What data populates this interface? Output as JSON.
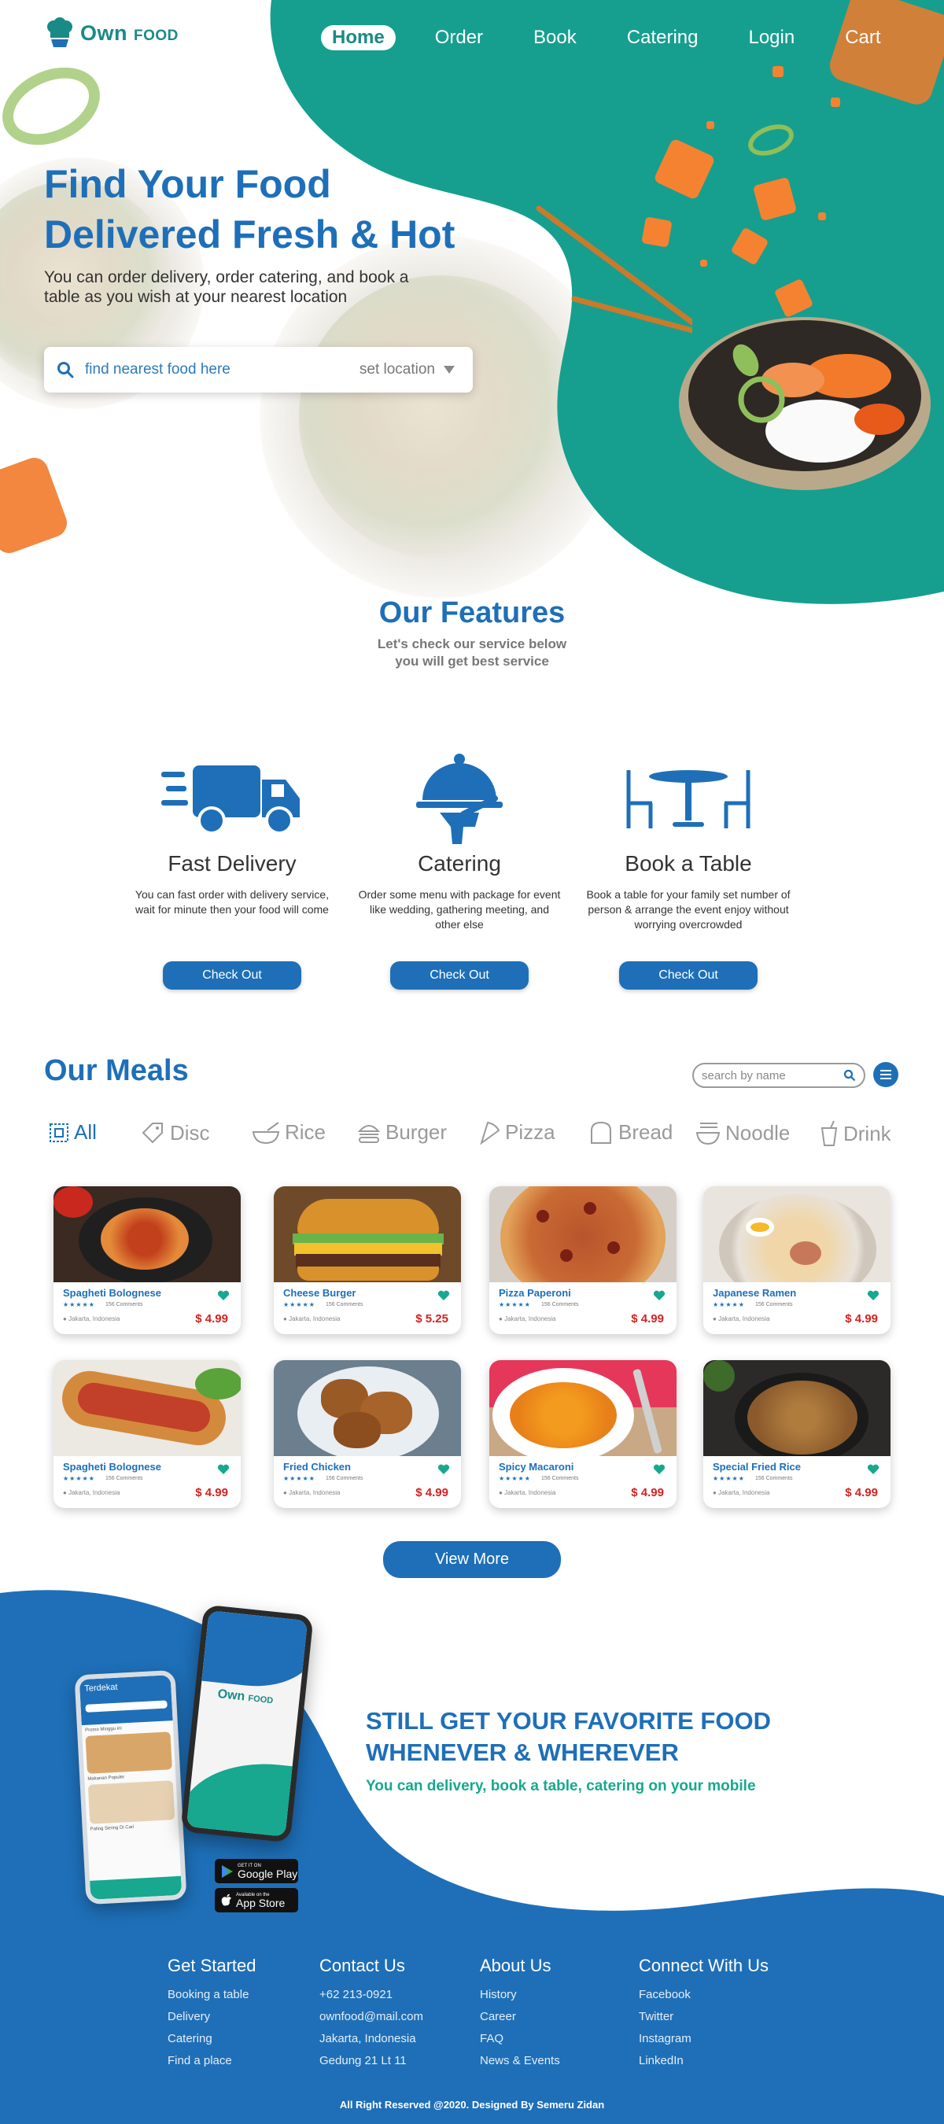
{
  "brand": {
    "name": "Own",
    "name_suffix": "FOOD"
  },
  "nav": {
    "home": "Home",
    "order": "Order",
    "book": "Book",
    "catering": "Catering",
    "login": "Login",
    "cart": "Cart"
  },
  "hero": {
    "title_line1": "Find Your Food",
    "title_line2": "Delivered Fresh & Hot",
    "subtitle": "You can order delivery, order catering, and book a table as you wish at your nearest location",
    "search_placeholder": "find nearest food here",
    "location_label": "set location"
  },
  "features": {
    "title": "Our Features",
    "subtitle_line1": "Let's check our service below",
    "subtitle_line2": "you will get best service",
    "items": [
      {
        "title": "Fast Delivery",
        "desc": "You can fast order with delivery service, wait for minute then your food will come",
        "button": "Check Out",
        "icon": "delivery-truck-icon"
      },
      {
        "title": "Catering",
        "desc": "Order some menu with package for event like wedding, gathering meeting, and other else",
        "button": "Check Out",
        "icon": "cloche-icon"
      },
      {
        "title": "Book a Table",
        "desc": "Book a table for your family set number of person & arrange the event enjoy without worrying overcrowded",
        "button": "Check Out",
        "icon": "dining-table-icon"
      }
    ]
  },
  "meals": {
    "title": "Our Meals",
    "search_placeholder": "search by name",
    "categories": [
      "All",
      "Disc",
      "Rice",
      "Burger",
      "Pizza",
      "Bread",
      "Noodle",
      "Drink"
    ],
    "stars": "★★★★★",
    "items": [
      {
        "name": "Spagheti Bolognese",
        "comments": "156 Comments",
        "location": "Jakarta, Indonesia",
        "price": "$ 4.99"
      },
      {
        "name": "Cheese Burger",
        "comments": "156 Comments",
        "location": "Jakarta, Indonesia",
        "price": "$ 5.25"
      },
      {
        "name": "Pizza Paperoni",
        "comments": "156 Comments",
        "location": "Jakarta, Indonesia",
        "price": "$ 4.99"
      },
      {
        "name": "Japanese Ramen",
        "comments": "156 Comments",
        "location": "Jakarta, Indonesia",
        "price": "$ 4.99"
      },
      {
        "name": "Spagheti Bolognese",
        "comments": "156 Comments",
        "location": "Jakarta, Indonesia",
        "price": "$ 4.99"
      },
      {
        "name": "Fried Chicken",
        "comments": "156 Comments",
        "location": "Jakarta, Indonesia",
        "price": "$ 4.99"
      },
      {
        "name": "Spicy Macaroni",
        "comments": "156 Comments",
        "location": "Jakarta, Indonesia",
        "price": "$ 4.99"
      },
      {
        "name": "Special Fried Rice",
        "comments": "156 Comments",
        "location": "Jakarta, Indonesia",
        "price": "$ 4.99"
      }
    ],
    "view_more": "View More"
  },
  "promo": {
    "title_line1": "STILL GET YOUR FAVORITE FOOD",
    "title_line2": "WHENEVER & WHEREVER",
    "subtitle": "You can delivery, book a table, catering on your mobile",
    "google_play_small": "GET IT ON",
    "google_play": "Google Play",
    "app_store_small": "Available on the",
    "app_store": "App Store",
    "phone_screen_title": "Terdekat",
    "phone_section1": "Promo Minggu ini",
    "phone_section2": "Makanan Populer",
    "phone_section3": "Paling Sering Di Cari"
  },
  "footer": {
    "columns": [
      {
        "title": "Get Started",
        "links": [
          "Booking a table",
          "Delivery",
          "Catering",
          "Find a place"
        ]
      },
      {
        "title": "Contact Us",
        "links": [
          "+62 213-0921",
          "ownfood@mail.com",
          "Jakarta, Indonesia",
          "Gedung 21 Lt 11"
        ]
      },
      {
        "title": "About Us",
        "links": [
          "History",
          "Career",
          "FAQ",
          "News & Events"
        ]
      },
      {
        "title": "Connect With Us",
        "links": [
          "Facebook",
          "Twitter",
          "Instagram",
          "LinkedIn"
        ]
      }
    ],
    "copyright": "All Right Reserved @2020. Designed By Semeru Zidan"
  },
  "colors": {
    "teal": "#169f8f",
    "blue": "#1e6fb8",
    "price_red": "#d32222"
  }
}
